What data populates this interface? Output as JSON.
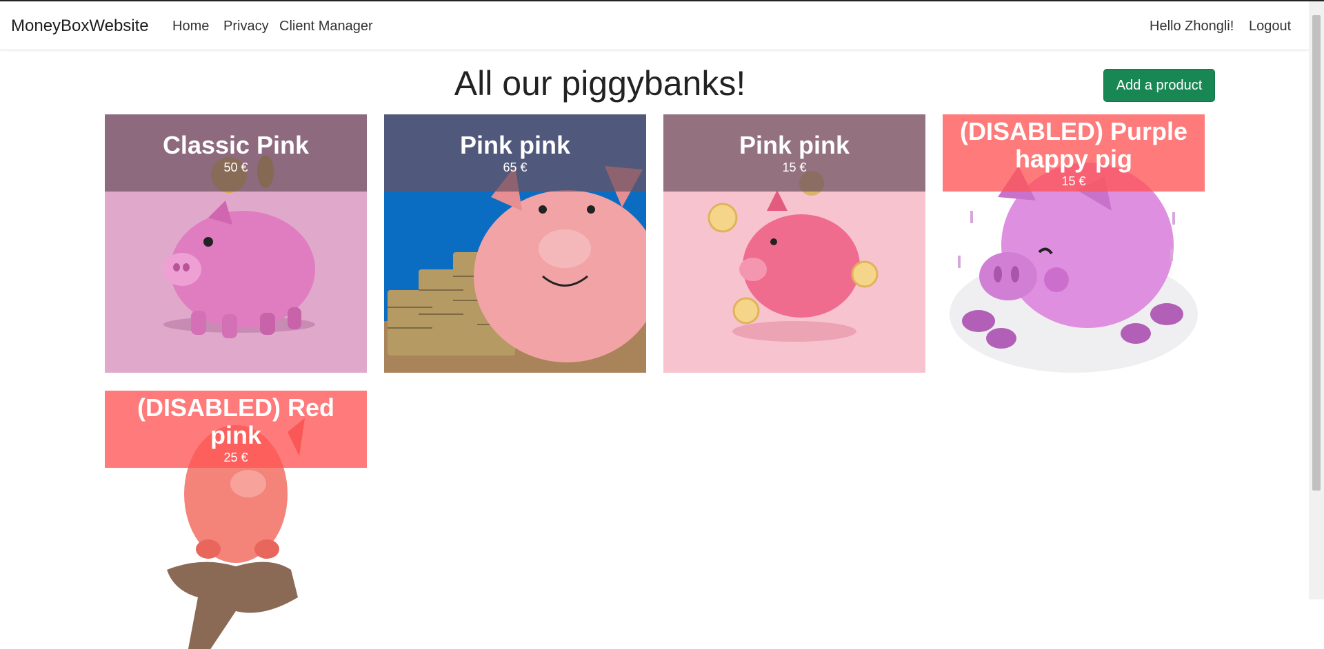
{
  "navbar": {
    "brand": "MoneyBoxWebsite",
    "links": [
      "Home",
      "Privacy",
      "Client Manager"
    ],
    "greeting": "Hello Zhongli!",
    "logout": "Logout"
  },
  "page": {
    "title": "All our piggybanks!",
    "add_button": "Add a product"
  },
  "products": [
    {
      "name": "Classic Pink",
      "price": "50 €",
      "disabled": false
    },
    {
      "name": "Pink pink",
      "price": "65 €",
      "disabled": false
    },
    {
      "name": "Pink pink",
      "price": "15 €",
      "disabled": false
    },
    {
      "name": "(DISABLED) Purple happy pig",
      "price": "15 €",
      "disabled": true
    },
    {
      "name": "(DISABLED) Red pink",
      "price": "25 €",
      "disabled": true
    }
  ],
  "colors": {
    "add_button": "#198754",
    "disabled_overlay": "#ff5555",
    "normal_overlay": "#6c5260"
  }
}
